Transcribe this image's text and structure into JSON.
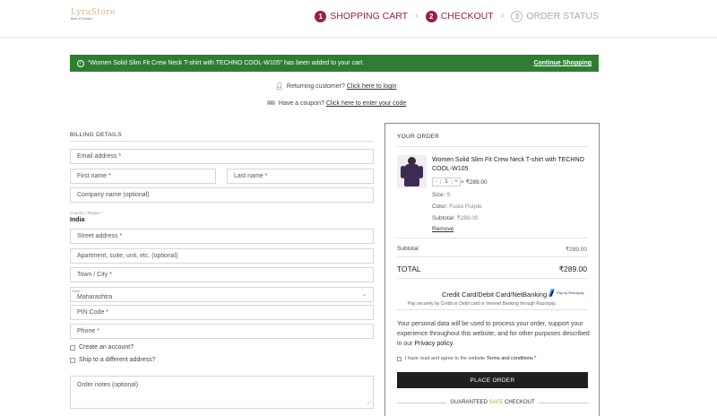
{
  "header": {
    "logo_text": "LyraStore",
    "logo_tagline": "Best of Fashion",
    "steps": [
      {
        "num": "1",
        "label": "SHOPPING CART"
      },
      {
        "num": "2",
        "label": "CHECKOUT"
      },
      {
        "num": "3",
        "label": "ORDER STATUS"
      }
    ]
  },
  "notice": {
    "message": "“Women Solid Slim Fit Crew Neck T-shirt with TECHNO COOL-W105” has been added to your cart.",
    "link": "Continue Shopping",
    "color": "#2e7d32"
  },
  "returning": {
    "text": "Returning customer?",
    "link": "Click here to login"
  },
  "coupon": {
    "text": "Have a coupon?",
    "link": "Click here to enter your code"
  },
  "billing": {
    "title": "BILLING DETAILS",
    "email": "Email address *",
    "first_name": "First name *",
    "last_name": "Last name *",
    "company": "Company name (optional)",
    "country_label": "Country / Region *",
    "country_value": "India",
    "street": "Street address *",
    "apartment": "Apartment, suite, unit, etc. (optional)",
    "city": "Town / City *",
    "state_label": "State *",
    "state_value": "Maharashtra",
    "pin": "PIN Code *",
    "phone": "Phone *",
    "create_account": "Create an account?",
    "ship_different": "Ship to a different address?",
    "order_notes": "Order notes (optional)"
  },
  "order": {
    "title": "YOUR ORDER",
    "product_name": "Women Solid Slim Fit Crew Neck T-shirt with TECHNO COOL-W105",
    "qty_minus": "-",
    "qty": "1",
    "qty_plus": "+",
    "qty_price": "× ₹289.00",
    "size_label": "Size:",
    "size_value": "S",
    "color_label": "Color:",
    "color_value": "Fusia Purple",
    "subtotal_line_label": "Subtotal:",
    "subtotal_line_value": "₹289.00",
    "remove": "Remove",
    "subtotal_label": "Subtotal",
    "subtotal_value": "₹289.00",
    "total_label": "TOTAL",
    "total_value": "₹289.00",
    "payment_method": "Credit Card/Debit Card/NetBanking",
    "razorpay_label": "Pay by Razorpay",
    "payment_sub": "Pay securely by Credit or Debit card or Internet Banking through Razorpay.",
    "privacy_text": "Your personal data will be used to process your order, support your experience throughout this website, and for other purposes described in our",
    "privacy_link": "Privacy policy",
    "terms_text": "I have read and agree to the website",
    "terms_link": "Terms and conditions",
    "terms_req": "*",
    "place_order": "PLACE ORDER",
    "guarantee_pre": "GUARANTEED",
    "guarantee_safe": "SAFE",
    "guarantee_post": "CHECKOUT"
  },
  "colors": {
    "accent": "#9c1b4d",
    "button": "#1f1f1f"
  }
}
